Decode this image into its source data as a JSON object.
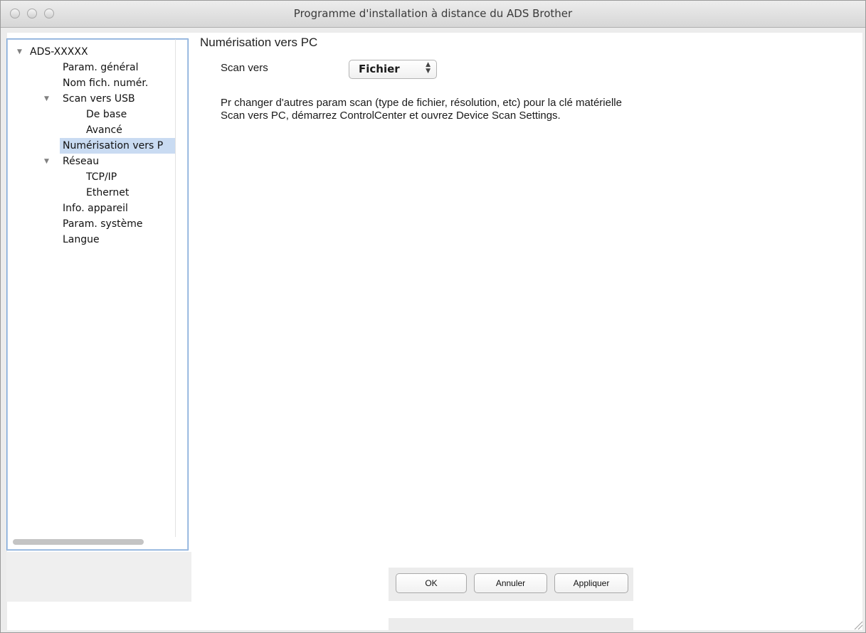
{
  "window": {
    "title": "Programme d'installation à distance du ADS Brother"
  },
  "sidebar": {
    "items": [
      {
        "label": "ADS-XXXXX",
        "level": 0,
        "expanded": true
      },
      {
        "label": "Param. général",
        "level": 1
      },
      {
        "label": "Nom fich. numér.",
        "level": 1
      },
      {
        "label": "Scan vers USB",
        "level": 1,
        "expanded": true
      },
      {
        "label": "De base",
        "level": 2
      },
      {
        "label": "Avancé",
        "level": 2
      },
      {
        "label": "Numérisation vers P",
        "level": 1,
        "selected": true
      },
      {
        "label": "Réseau",
        "level": 1,
        "expanded": true
      },
      {
        "label": "TCP/IP",
        "level": 2
      },
      {
        "label": "Ethernet",
        "level": 2
      },
      {
        "label": "Info. appareil",
        "level": 1
      },
      {
        "label": "Param. système",
        "level": 1
      },
      {
        "label": "Langue",
        "level": 1
      }
    ]
  },
  "main": {
    "section_title": "Numérisation vers PC",
    "scan_to_label": "Scan vers",
    "scan_to_value": "Fichier",
    "info_line1": "Pr changer d'autres param scan (type de fichier, résolution, etc) pour la clé matérielle",
    "info_line2": "Scan vers PC, démarrez ControlCenter et ouvrez Device Scan Settings."
  },
  "buttons": {
    "ok": "OK",
    "cancel": "Annuler",
    "apply": "Appliquer"
  },
  "colors": {
    "selection": "#c9dbf2",
    "focus_ring": "#7fa7d8"
  }
}
